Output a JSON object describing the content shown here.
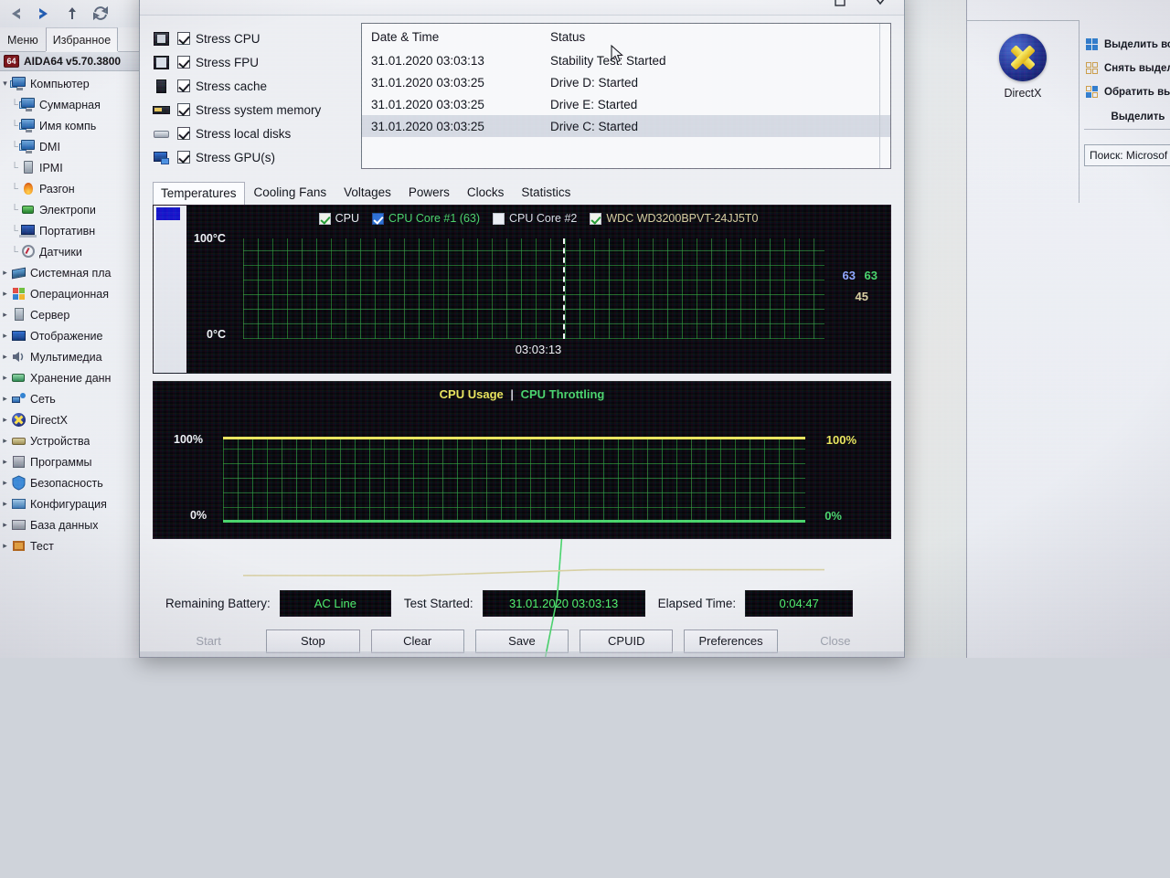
{
  "left_app": {
    "toolbar_icons": [
      "back-arrow-icon",
      "forward-arrow-icon",
      "up-arrow-icon",
      "refresh-icon"
    ],
    "menus": [
      {
        "label": "Меню",
        "active": false
      },
      {
        "label": "Избранное",
        "active": true
      }
    ],
    "product": "AIDA64 v5.70.3800",
    "tree": [
      {
        "label": "Компьютер",
        "level": 0,
        "expanded": true,
        "icon": "computer-icon"
      },
      {
        "label": "Суммарная",
        "level": 2,
        "icon": "computer-icon"
      },
      {
        "label": "Имя компь",
        "level": 2,
        "icon": "computer-icon"
      },
      {
        "label": "DMI",
        "level": 2,
        "icon": "computer-icon"
      },
      {
        "label": "IPMI",
        "level": 2,
        "icon": "server-icon"
      },
      {
        "label": "Разгон",
        "level": 2,
        "icon": "flame-icon"
      },
      {
        "label": "Электропи",
        "level": 2,
        "icon": "battery-icon"
      },
      {
        "label": "Портативн",
        "level": 2,
        "icon": "laptop-icon"
      },
      {
        "label": "Датчики",
        "level": 2,
        "icon": "gauge-icon"
      },
      {
        "label": "Системная пла",
        "level": 1,
        "icon": "motherboard-icon"
      },
      {
        "label": "Операционная",
        "level": 1,
        "icon": "windows-icon"
      },
      {
        "label": "Сервер",
        "level": 1,
        "icon": "server-icon"
      },
      {
        "label": "Отображение",
        "level": 1,
        "icon": "display-icon"
      },
      {
        "label": "Мультимедиа",
        "level": 1,
        "icon": "speaker-icon"
      },
      {
        "label": "Хранение данн",
        "level": 1,
        "icon": "storage-icon"
      },
      {
        "label": "Сеть",
        "level": 1,
        "icon": "network-icon"
      },
      {
        "label": "DirectX",
        "level": 1,
        "icon": "directx-icon"
      },
      {
        "label": "Устройства",
        "level": 1,
        "icon": "devices-icon"
      },
      {
        "label": "Программы",
        "level": 1,
        "icon": "programs-icon"
      },
      {
        "label": "Безопасность",
        "level": 1,
        "icon": "shield-icon"
      },
      {
        "label": "Конфигурация",
        "level": 1,
        "icon": "config-icon"
      },
      {
        "label": "База данных",
        "level": 1,
        "icon": "database-icon"
      },
      {
        "label": "Тест",
        "level": 1,
        "icon": "benchmark-icon"
      }
    ]
  },
  "right_panel": {
    "directx_label": "DirectX",
    "select_all": "Выделить все",
    "deselect": "Снять выделе",
    "invert": "Обратить выд",
    "select_caption": "Выделить",
    "search_value": "Поиск: Microsof"
  },
  "dialog": {
    "window_buttons": [
      "maximize-button",
      "close-button"
    ],
    "stress_options": [
      {
        "label": "Stress CPU",
        "checked": true,
        "icon": "cpu-icon"
      },
      {
        "label": "Stress FPU",
        "checked": true,
        "icon": "fpu-icon"
      },
      {
        "label": "Stress cache",
        "checked": true,
        "icon": "cache-icon"
      },
      {
        "label": "Stress system memory",
        "checked": true,
        "icon": "memory-icon"
      },
      {
        "label": "Stress local disks",
        "checked": true,
        "icon": "disk-icon"
      },
      {
        "label": "Stress GPU(s)",
        "checked": true,
        "icon": "gpu-icon"
      }
    ],
    "log": {
      "headers": [
        "Date & Time",
        "Status"
      ],
      "rows": [
        {
          "datetime": "31.01.2020 03:03:13",
          "status": "Stability Test: Started",
          "selected": false
        },
        {
          "datetime": "31.01.2020 03:03:25",
          "status": "Drive D: Started",
          "selected": false
        },
        {
          "datetime": "31.01.2020 03:03:25",
          "status": "Drive E: Started",
          "selected": false
        },
        {
          "datetime": "31.01.2020 03:03:25",
          "status": "Drive C: Started",
          "selected": true
        }
      ]
    },
    "tabs": [
      {
        "label": "Temperatures",
        "active": true
      },
      {
        "label": "Cooling Fans",
        "active": false
      },
      {
        "label": "Voltages",
        "active": false
      },
      {
        "label": "Powers",
        "active": false
      },
      {
        "label": "Clocks",
        "active": false
      },
      {
        "label": "Statistics",
        "active": false
      }
    ],
    "status": {
      "battery_label": "Remaining Battery:",
      "battery_value": "AC Line",
      "started_label": "Test Started:",
      "started_value": "31.01.2020 03:03:13",
      "elapsed_label": "Elapsed Time:",
      "elapsed_value": "0:04:47"
    },
    "buttons": [
      {
        "label": "Start",
        "disabled": true
      },
      {
        "label": "Stop",
        "disabled": false
      },
      {
        "label": "Clear",
        "disabled": false
      },
      {
        "label": "Save",
        "disabled": false
      },
      {
        "label": "CPUID",
        "disabled": false
      },
      {
        "label": "Preferences",
        "disabled": false
      },
      {
        "label": "Close",
        "disabled": true
      }
    ]
  },
  "chart_data": [
    {
      "type": "line",
      "name": "temperatures-graph",
      "title": "",
      "ylabel_top": "100°C",
      "ylabel_bottom": "0°C",
      "ylim": [
        0,
        100
      ],
      "xlabel": "",
      "x_tick_label": "03:03:13",
      "grid": true,
      "legend_position": "top-center",
      "legend": [
        {
          "label": "CPU",
          "checked": true,
          "checkbox_style": "green-check",
          "color": "#e9ecf2"
        },
        {
          "label": "CPU Core #1 (63)",
          "checked": true,
          "checkbox_style": "blue-check",
          "color": "#47d36a"
        },
        {
          "label": "CPU Core #2",
          "checked": false,
          "checkbox_style": "empty",
          "color": "#d8dde6"
        },
        {
          "label": "WDC WD3200BPVT-24JJ5T0",
          "checked": true,
          "checkbox_style": "green-check",
          "color": "#d6cfa0"
        }
      ],
      "series": [
        {
          "name": "CPU",
          "current_value": 63,
          "color": "#8da7ff",
          "label_text": "63"
        },
        {
          "name": "CPU Core #1",
          "current_value": 63,
          "color": "#47d36a",
          "label_text": "63"
        },
        {
          "name": "WDC WD3200BPVT-24JJ5T0",
          "current_value": 45,
          "color": "#d6cfa0",
          "label_text": "45"
        }
      ],
      "values_right": [
        "63",
        "63",
        "45"
      ]
    },
    {
      "type": "line",
      "name": "cpu-usage-graph",
      "title_parts": [
        {
          "text": "CPU Usage",
          "color": "#e8e45a"
        },
        {
          "text": "|",
          "color": "#cccccc"
        },
        {
          "text": "CPU Throttling",
          "color": "#47d36a"
        }
      ],
      "ylabel_top_left": "100%",
      "ylabel_bottom_left": "0%",
      "ylabel_top_right": "100%",
      "ylabel_bottom_right": "0%",
      "ylim": [
        0,
        100
      ],
      "grid": true,
      "series": [
        {
          "name": "CPU Usage",
          "value": 100,
          "color": "#e8e45a"
        },
        {
          "name": "CPU Throttling",
          "value": 0,
          "color": "#47d36a"
        }
      ]
    }
  ]
}
